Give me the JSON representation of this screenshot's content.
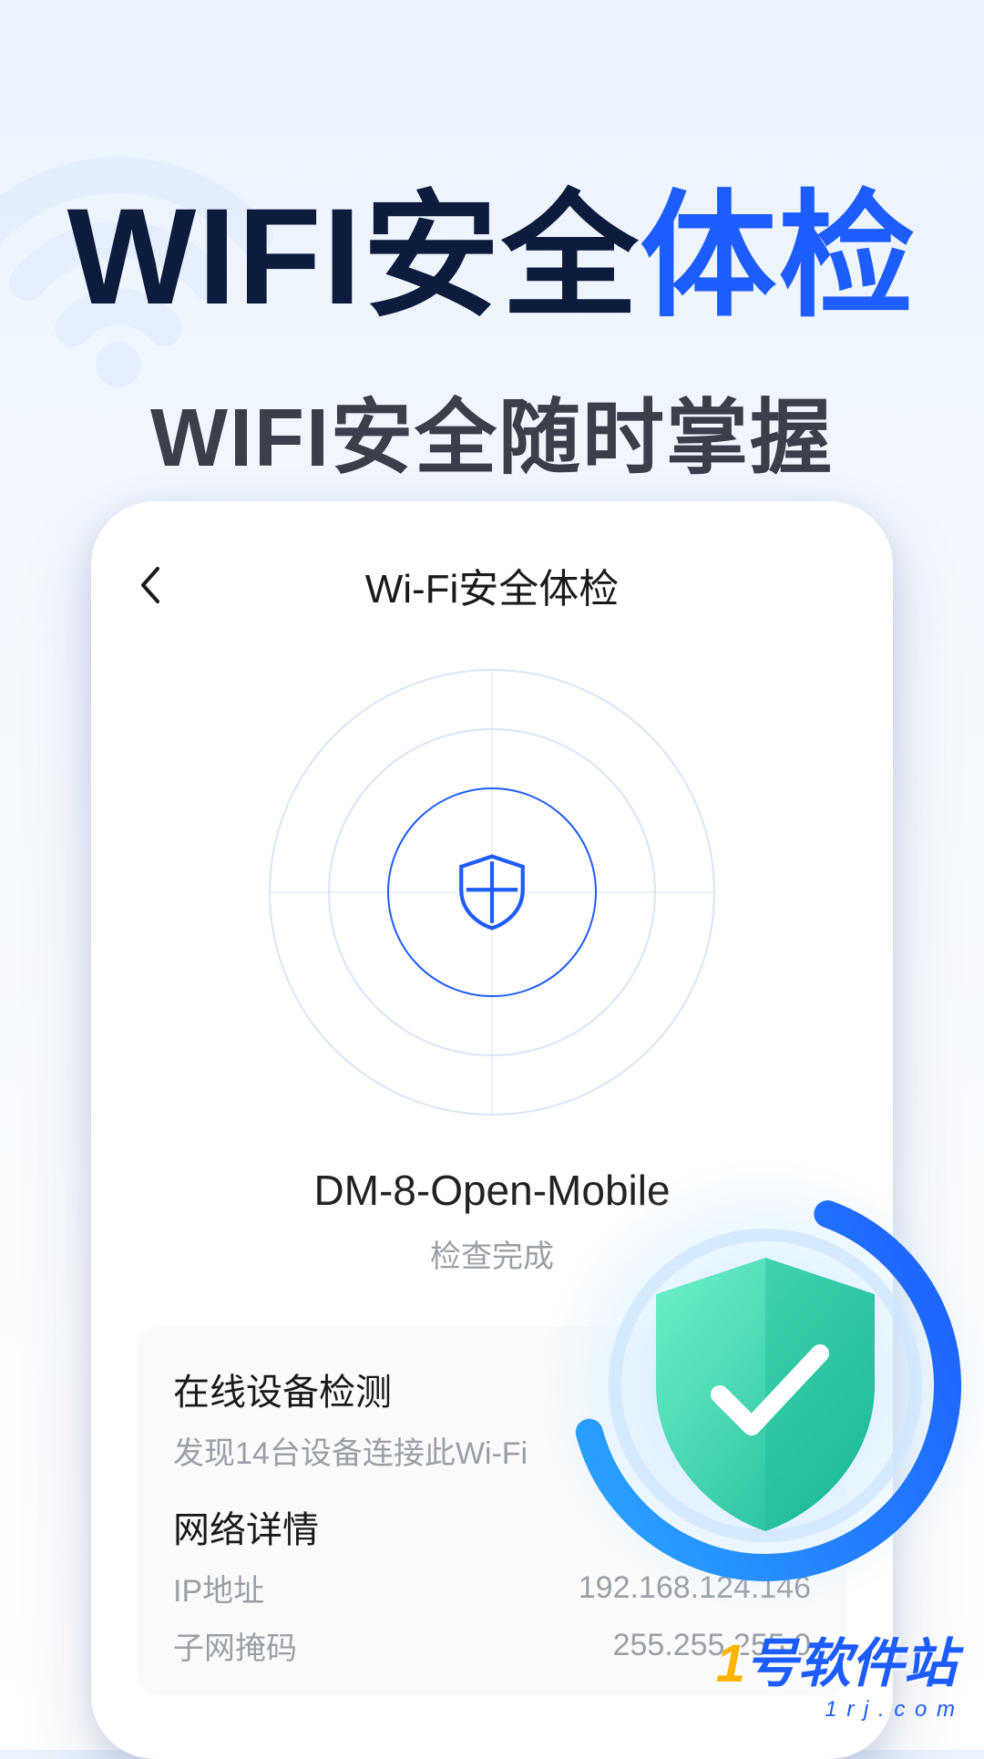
{
  "hero": {
    "title_part1": "WIFI安全",
    "title_accent": "体检",
    "subtitle": "WIFI安全随时掌握"
  },
  "app": {
    "title": "Wi-Fi安全体检",
    "wifi_name": "DM-8-Open-Mobile",
    "status": "检查完成"
  },
  "devices": {
    "title": "在线设备检测",
    "subtitle": "发现14台设备连接此Wi-Fi"
  },
  "network": {
    "title": "网络详情",
    "rows": [
      {
        "label": "IP地址",
        "value": "192.168.124.146"
      },
      {
        "label": "子网掩码",
        "value": "255.255.255.0"
      }
    ]
  },
  "watermark": {
    "one": "1",
    "text": "号软件站",
    "url": "1 r j . c o m"
  },
  "colors": {
    "accent": "#1d5cff",
    "shield_green": "#2fd6a8"
  }
}
